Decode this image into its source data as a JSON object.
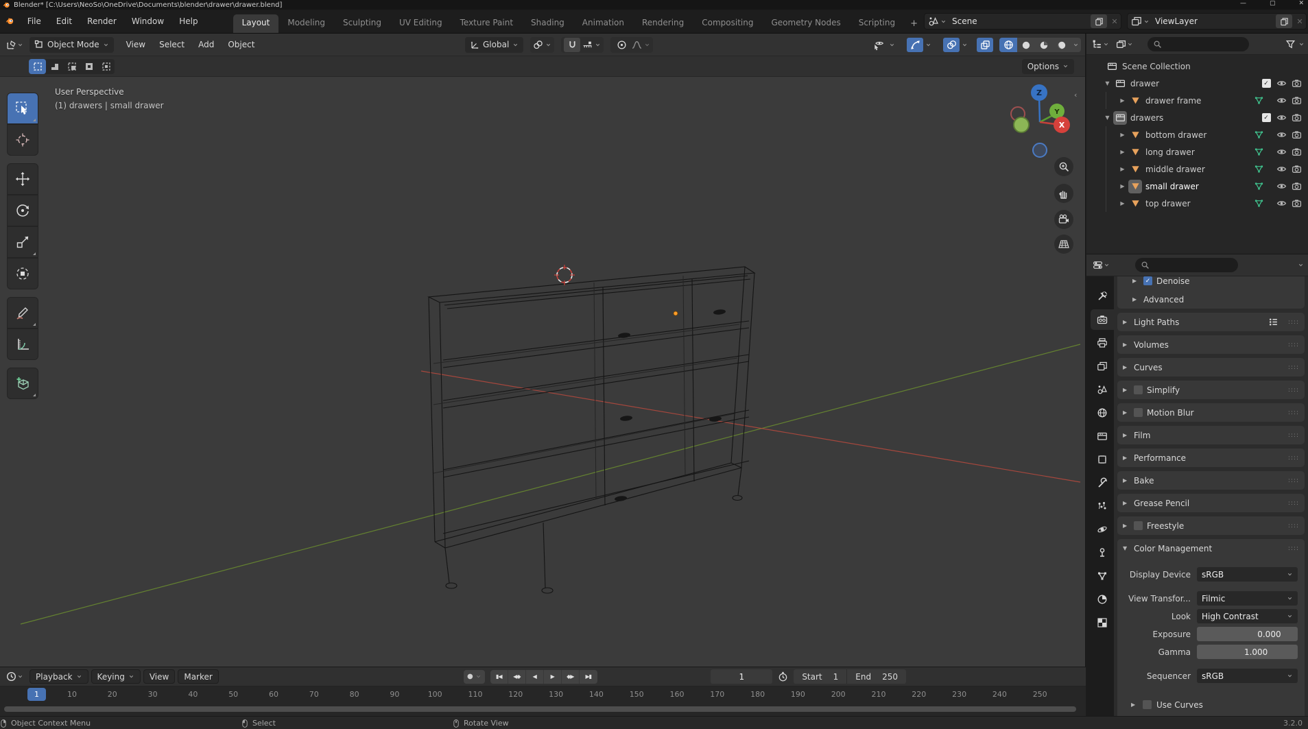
{
  "titlebar": {
    "title": "Blender* [C:\\Users\\NeoSo\\OneDrive\\Documents\\blender\\drawer\\drawer.blend]",
    "window_controls": {
      "minimize": "—",
      "maximize": "▢",
      "close": "✕"
    }
  },
  "topbar": {
    "menus": [
      {
        "label": "File"
      },
      {
        "label": "Edit"
      },
      {
        "label": "Render"
      },
      {
        "label": "Window"
      },
      {
        "label": "Help"
      }
    ],
    "tabs": [
      {
        "label": "Layout",
        "active": true
      },
      {
        "label": "Modeling"
      },
      {
        "label": "Sculpting"
      },
      {
        "label": "UV Editing"
      },
      {
        "label": "Texture Paint"
      },
      {
        "label": "Shading"
      },
      {
        "label": "Animation"
      },
      {
        "label": "Rendering"
      },
      {
        "label": "Compositing"
      },
      {
        "label": "Geometry Nodes"
      },
      {
        "label": "Scripting"
      }
    ],
    "add_tab": "+",
    "scene": {
      "label": "Scene"
    },
    "view_layer": {
      "label": "ViewLayer"
    }
  },
  "viewport": {
    "header": {
      "mode": "Object Mode",
      "menus": [
        {
          "label": "View"
        },
        {
          "label": "Select"
        },
        {
          "label": "Add"
        },
        {
          "label": "Object"
        }
      ],
      "orientation": "Global",
      "options_label": "Options"
    },
    "overlay": {
      "line1": "User Perspective",
      "line2": "(1) drawers | small drawer"
    },
    "gizmo": {
      "z": "Z",
      "y": "Y",
      "x": "X"
    },
    "toolbar_icons": [
      "select-box",
      "cursor",
      "move",
      "rotate",
      "scale",
      "transform",
      "annotate",
      "measure",
      "add-cube"
    ],
    "select_mode_icons": [
      "set",
      "extend",
      "subtract",
      "difference",
      "intersect"
    ],
    "axis_colors": {
      "x": "#b94a3e",
      "y": "#6c8f2f",
      "z": "#3773c4"
    }
  },
  "outliner": {
    "rows": [
      {
        "label": "Scene Collection",
        "indent": 0,
        "collection": true,
        "nocaret": true
      },
      {
        "label": "drawer",
        "indent": 1,
        "collection": true,
        "open": true,
        "checkbox": true,
        "eye": true,
        "camera": true
      },
      {
        "label": "drawer frame",
        "indent": 2,
        "mesh": true,
        "caret": true,
        "data_icon": true,
        "eye": true,
        "camera": true
      },
      {
        "label": "drawers",
        "indent": 1,
        "collection": true,
        "open": true,
        "icon_hl": true,
        "checkbox": true,
        "eye": true,
        "camera": true
      },
      {
        "label": "bottom drawer",
        "indent": 2,
        "mesh": true,
        "caret": true,
        "data_icon": true,
        "eye": true,
        "camera": true
      },
      {
        "label": "long drawer",
        "indent": 2,
        "mesh": true,
        "caret": true,
        "data_icon": true,
        "eye": true,
        "camera": true
      },
      {
        "label": "middle drawer",
        "indent": 2,
        "mesh": true,
        "caret": true,
        "data_icon": true,
        "eye": true,
        "camera": true
      },
      {
        "label": "small drawer",
        "indent": 2,
        "mesh": true,
        "caret": true,
        "data_icon": true,
        "icon_hl": true,
        "active": true,
        "eye": true,
        "camera": true
      },
      {
        "label": "top drawer",
        "indent": 2,
        "mesh": true,
        "caret": true,
        "data_icon": true,
        "eye": true,
        "camera": true
      }
    ]
  },
  "properties": {
    "sampling_sub": {
      "denoise": "Denoise",
      "advanced": "Advanced"
    },
    "panels": [
      {
        "label": "Light Paths",
        "preset": true,
        "grip": "::::"
      },
      {
        "label": "Volumes",
        "grip": "::::"
      },
      {
        "label": "Curves",
        "grip": "::::"
      },
      {
        "label": "Simplify",
        "cb": true,
        "grip": "::::"
      },
      {
        "label": "Motion Blur",
        "cb": true,
        "grip": "::::"
      },
      {
        "label": "Film",
        "grip": "::::"
      },
      {
        "label": "Performance",
        "grip": "::::"
      },
      {
        "label": "Bake",
        "grip": "::::"
      },
      {
        "label": "Grease Pencil",
        "grip": "::::"
      },
      {
        "label": "Freestyle",
        "cb": true,
        "grip": "::::"
      }
    ],
    "color_management": {
      "title": "Color Management",
      "grip": "::::",
      "rows": [
        {
          "label": "Display Device",
          "value": "sRGB",
          "select": true,
          "gap": "gap12"
        },
        {
          "label": "View Transfor...",
          "value": "Filmic",
          "select": true,
          "gap": "gap10"
        },
        {
          "label": "Look",
          "value": "High Contrast",
          "select": true
        },
        {
          "label": "Exposure",
          "value": "0.000",
          "slider": true,
          "fill": 48
        },
        {
          "label": "Gamma",
          "value": "1.000",
          "slider": true,
          "fill": 19
        },
        {
          "label": "Sequencer",
          "value": "sRGB",
          "select": true,
          "gap": "gap10"
        }
      ],
      "use_curves": "Use Curves"
    },
    "tabs": [
      {
        "name": "tool",
        "sym": "#i-tool"
      },
      {
        "name": "render",
        "sym": "#i-render",
        "active": true
      },
      {
        "name": "output",
        "sym": "#i-output"
      },
      {
        "name": "view-layer",
        "sym": "#i-vlayer"
      },
      {
        "name": "scene",
        "sym": "#i-scene"
      },
      {
        "name": "world",
        "sym": "#i-world"
      },
      {
        "name": "collection",
        "sym": "#i-collection"
      },
      {
        "name": "object",
        "sym": "#i-object"
      },
      {
        "name": "modifiers",
        "sym": "#i-modifier"
      },
      {
        "name": "particles",
        "sym": "#i-particles"
      },
      {
        "name": "physics",
        "sym": "#i-physics"
      },
      {
        "name": "constraints",
        "sym": "#i-constraints"
      },
      {
        "name": "object-data",
        "sym": "#i-data"
      },
      {
        "name": "material",
        "sym": "#i-material"
      },
      {
        "name": "texture",
        "sym": "#i-texture"
      }
    ]
  },
  "timeline": {
    "menus": [
      {
        "label": "Playback",
        "chev": true
      },
      {
        "label": "Keying",
        "chev": true
      },
      {
        "label": "View"
      },
      {
        "label": "Marker"
      }
    ],
    "record_glyph": "●",
    "transport": [
      {
        "g": "▮◀"
      },
      {
        "g": "◀◆"
      },
      {
        "g": "◀"
      },
      {
        "g": "▶"
      },
      {
        "g": "◆▶"
      },
      {
        "g": "▶▮"
      }
    ],
    "frame_current": "1",
    "start_label": "Start",
    "start_value": "1",
    "end_label": "End",
    "end_value": "250",
    "current_tick": "1",
    "ticks": [
      "10",
      "20",
      "30",
      "40",
      "50",
      "60",
      "70",
      "80",
      "90",
      "100",
      "110",
      "120",
      "130",
      "140",
      "150",
      "160",
      "170",
      "180",
      "190",
      "200",
      "210",
      "220",
      "230",
      "240",
      "250"
    ]
  },
  "statusbar": {
    "items": [
      {
        "button": "left-mouse",
        "label": "Select"
      },
      {
        "button": "middle-mouse",
        "label": "Rotate View"
      },
      {
        "button": "right-mouse",
        "label": "Object Context Menu"
      }
    ],
    "version": "3.2.0"
  },
  "colors": {
    "accent_blue": "#4772b3",
    "mesh_orange": "#e8a25c",
    "mesh_data_green": "#3fbd8a"
  }
}
